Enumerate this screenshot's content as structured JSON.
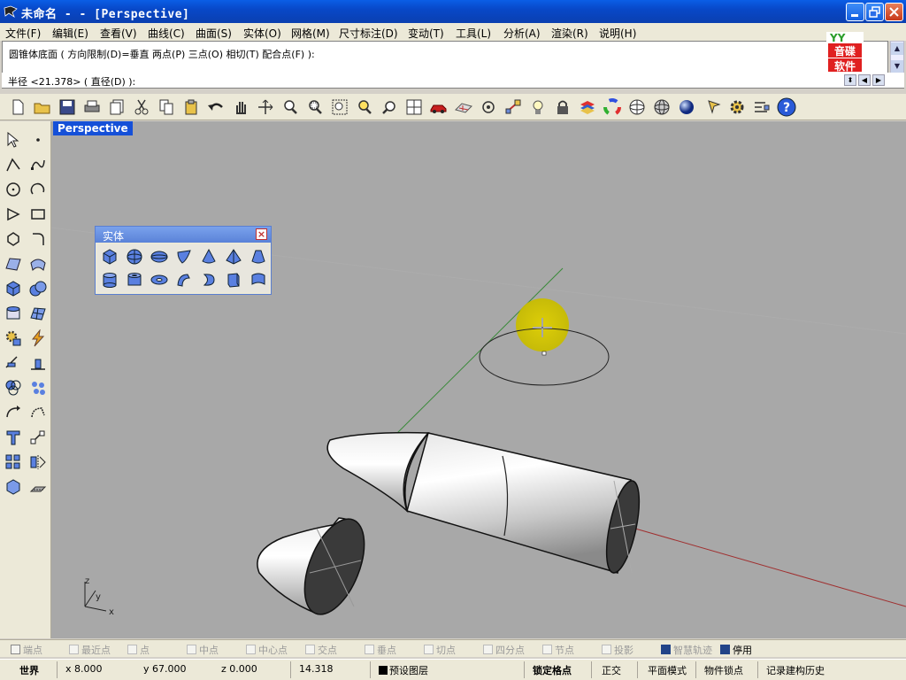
{
  "window": {
    "title": "未命名 -  - [Perspective]"
  },
  "menu": [
    {
      "label": "文件(F)"
    },
    {
      "label": "编辑(E)"
    },
    {
      "label": "查看(V)"
    },
    {
      "label": "曲线(C)"
    },
    {
      "label": "曲面(S)"
    },
    {
      "label": "实体(O)"
    },
    {
      "label": "网格(M)"
    },
    {
      "label": "尺寸标注(D)"
    },
    {
      "label": "变动(T)"
    },
    {
      "label": "工具(L)"
    },
    {
      "label": "分析(A)"
    },
    {
      "label": "渲染(R)"
    },
    {
      "label": "说明(H)"
    }
  ],
  "command": {
    "history_line": "圆锥体底面 ( 方向限制(D)=垂直  两点(P)  三点(O)  相切(T)  配合点(F) ):",
    "prompt": "半径 <21.378> ( 直径(D) ):"
  },
  "logo": {
    "top": "YY",
    "line1": "音碟",
    "line2": "软件"
  },
  "toolbar_icons": [
    "new-file-icon",
    "open-folder-icon",
    "save-icon",
    "print-icon",
    "import-icon",
    "cut-icon",
    "copy-icon",
    "paste-icon",
    "undo-icon",
    "pan-hand-icon",
    "rotate-view-icon",
    "zoom-icon",
    "zoom-window-icon",
    "zoom-extents-icon",
    "zoom-selected-icon",
    "redo-view-icon",
    "four-viewports-icon",
    "car-icon",
    "plane-icon",
    "target-icon",
    "snap-icon",
    "light-icon",
    "lock-icon",
    "layer-icon",
    "color-wheel-icon",
    "wireframe-sphere-icon",
    "grid-sphere-icon",
    "render-sphere-icon",
    "pen-icon",
    "gear-icon",
    "options-icon",
    "help-icon"
  ],
  "viewport": {
    "label": "Perspective",
    "axes": {
      "z": "z",
      "y": "y",
      "x": "x"
    }
  },
  "solid_panel": {
    "title": "实体",
    "close": "×"
  },
  "osnap": [
    {
      "label": "端点",
      "checked": false
    },
    {
      "label": "最近点",
      "checked": false
    },
    {
      "label": "点",
      "checked": false
    },
    {
      "label": "中点",
      "checked": false
    },
    {
      "label": "中心点",
      "checked": false
    },
    {
      "label": "交点",
      "checked": false
    },
    {
      "label": "垂点",
      "checked": false
    },
    {
      "label": "切点",
      "checked": false
    },
    {
      "label": "四分点",
      "checked": false
    },
    {
      "label": "节点",
      "checked": false
    },
    {
      "label": "投影",
      "checked": false
    },
    {
      "label": "智慧轨迹",
      "checked": true
    },
    {
      "label": "停用",
      "checked": true
    }
  ],
  "status": {
    "cplane": "世界",
    "x": "x 8.000",
    "y": "y 67.000",
    "z": "z 0.000",
    "distance": "14.318",
    "layer": "预设图层",
    "grid_snap": "锁定格点",
    "ortho": "正交",
    "planar": "平面模式",
    "osnap": "物件锁点",
    "history": "记录建构历史"
  },
  "colors": {
    "titlebar": "#0848c8",
    "viewport_bg": "#a8a8a8",
    "viewport_tab": "#1550d8",
    "x_axis": "#a03030",
    "y_axis": "#3a8a3a",
    "cursor_highlight": "#d8c800"
  }
}
